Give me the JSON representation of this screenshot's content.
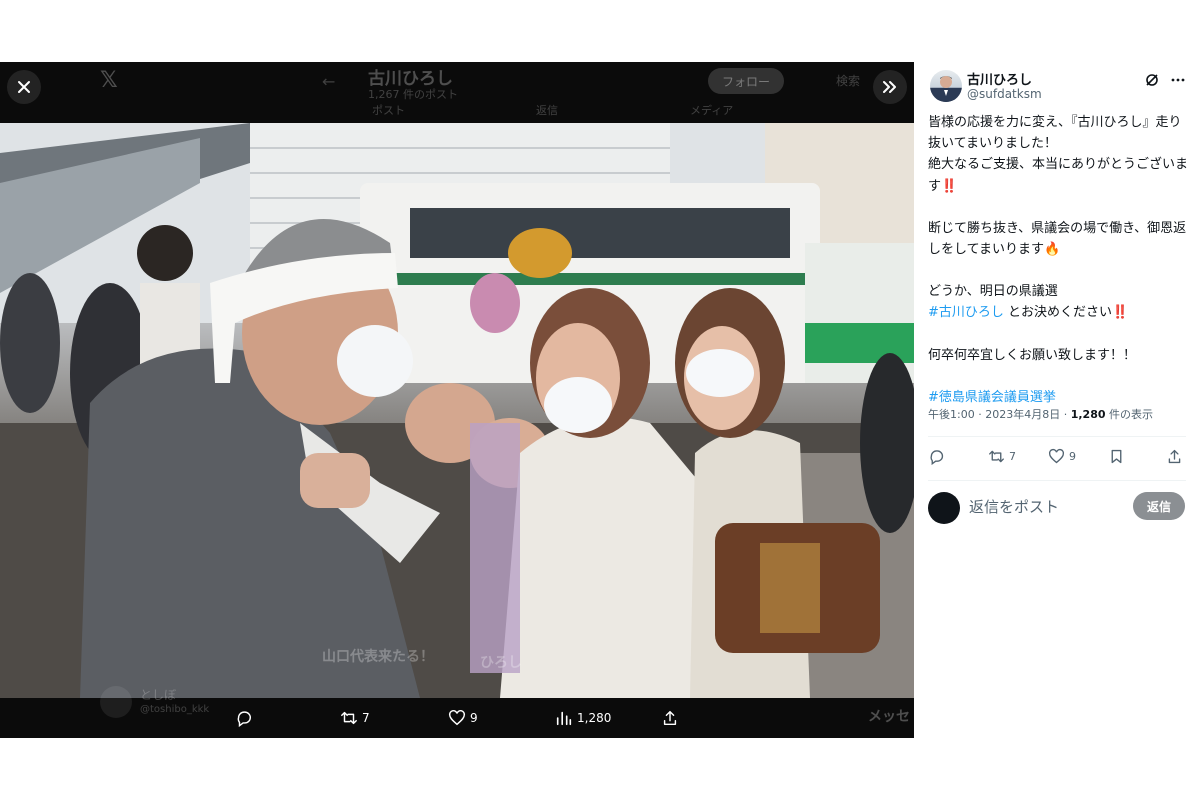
{
  "viewer": {
    "background_header": {
      "name": "古川ひろし",
      "subtitle": "1,267 件のポスト",
      "follow_label": "フォロー",
      "tabs": [
        "ポスト",
        "返信",
        "メディア"
      ],
      "search_label": "検索"
    },
    "background_footer": {
      "user_name": "としぼ",
      "user_handle": "@toshibo_kkk",
      "banner_text": "山口代表来たる！",
      "banner_text2": "ひろし",
      "right_text": "メッセ"
    },
    "actions": {
      "reply_count": "",
      "retweet_count": "7",
      "like_count": "9",
      "views_count": "1,280"
    }
  },
  "tweet": {
    "author_name": "古川ひろし",
    "author_handle": "@sufdatksm",
    "lines": [
      "皆様の応援を力に変え、『古川ひろし』走り抜いてまいりました！",
      "絶大なるご支援、本当にありがとうございます‼️",
      "断じて勝ち抜き、県議会の場で働き、御恩返しをしてまいります🔥",
      "どうか、明日の県議選",
      "#古川ひろし",
      " とお決めください‼️",
      "何卒何卒宜しくお願い致します！！",
      "#徳島県議会議員選挙"
    ],
    "time": "午後1:00",
    "date": "2023年4月8日",
    "views_count": "1,280",
    "views_label": "件の表示",
    "retweet_count": "7",
    "like_count": "9",
    "reply_placeholder": "返信をポスト",
    "reply_button": "返信"
  },
  "colors": {
    "link": "#1d9bf0",
    "viewer_bg": "#0b0b0b",
    "reply_button_bg": "#8b8f93"
  },
  "icons": [
    "close-icon",
    "x-logo-icon",
    "back-arrow-icon",
    "collapse-panel-icon",
    "grok-icon",
    "more-icon",
    "reply-icon",
    "retweet-icon",
    "like-icon",
    "views-icon",
    "bookmark-icon",
    "share-icon"
  ]
}
